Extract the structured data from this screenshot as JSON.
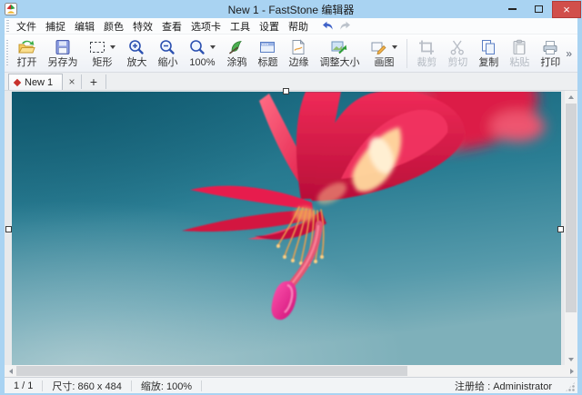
{
  "window": {
    "title": "New 1 - FastStone 编辑器",
    "close_glyph": "×"
  },
  "menu": {
    "items": [
      "文件",
      "捕捉",
      "编辑",
      "颜色",
      "特效",
      "查看",
      "选项卡",
      "工具",
      "设置",
      "帮助"
    ]
  },
  "toolbar": {
    "buttons": [
      {
        "label": "打开",
        "icon": "open-folder",
        "enabled": true
      },
      {
        "label": "另存为",
        "icon": "save-floppy",
        "enabled": true
      },
      {
        "label": "矩形",
        "icon": "rect-select",
        "enabled": true,
        "dropdown": true
      },
      {
        "label": "放大",
        "icon": "zoom-in",
        "enabled": true
      },
      {
        "label": "缩小",
        "icon": "zoom-out",
        "enabled": true
      },
      {
        "label": "100%",
        "icon": "zoom-actual",
        "enabled": true,
        "dropdown": true
      },
      {
        "label": "涂鸦",
        "icon": "doodle-brush",
        "enabled": true
      },
      {
        "label": "标题",
        "icon": "title-window",
        "enabled": true
      },
      {
        "label": "边缘",
        "icon": "edge-page",
        "enabled": true
      },
      {
        "label": "调整大小",
        "icon": "resize-image",
        "enabled": true
      },
      {
        "label": "画图",
        "icon": "draw-pencil",
        "enabled": true,
        "dropdown": true
      },
      {
        "label": "裁剪",
        "icon": "crop",
        "enabled": false
      },
      {
        "label": "剪切",
        "icon": "cut-scissors",
        "enabled": false
      },
      {
        "label": "复制",
        "icon": "copy-pages",
        "enabled": true
      },
      {
        "label": "粘贴",
        "icon": "paste-clipboard",
        "enabled": false
      },
      {
        "label": "打印",
        "icon": "print",
        "enabled": true
      }
    ],
    "overflow": "»"
  },
  "tabbar": {
    "active_tab": "New 1",
    "close": "×",
    "new_tab": "+"
  },
  "statusbar": {
    "page": "1 / 1",
    "size": "尺寸: 860 x 484",
    "zoom": "缩放: 100%",
    "registered": "注册给 : Administrator"
  },
  "colors": {
    "titlebar_blue": "#a9d3f2",
    "close_button_red": "#d14f4b",
    "flower_red": "#dc1040",
    "bud_magenta": "#cf0e78",
    "stamen_orange": "#f2a14c",
    "background_teal_top": "#14637a",
    "background_teal_bottom": "#7eb0ba"
  }
}
